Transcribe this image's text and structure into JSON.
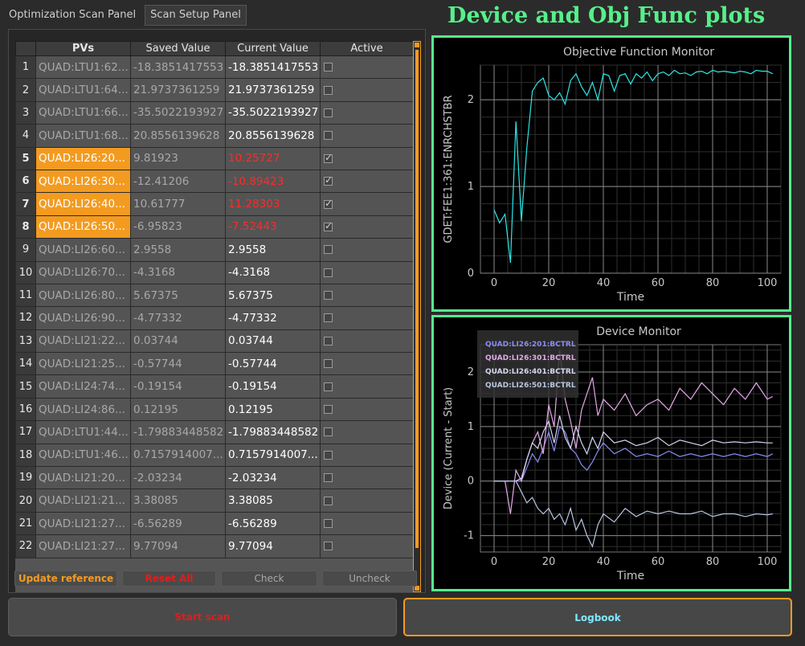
{
  "tabs": [
    {
      "label": "Optimization Scan Panel",
      "active": true
    },
    {
      "label": "Scan Setup Panel",
      "active": false
    }
  ],
  "table": {
    "headers": [
      "PVs",
      "Saved Value",
      "Current Value",
      "Active"
    ],
    "rows": [
      {
        "n": "1",
        "pv": "QUAD:LTU1:62...",
        "saved": "-18.3851417553",
        "current": "-18.3851417553",
        "active": false
      },
      {
        "n": "2",
        "pv": "QUAD:LTU1:64...",
        "saved": "21.9737361259",
        "current": "21.9737361259",
        "active": false
      },
      {
        "n": "3",
        "pv": "QUAD:LTU1:66...",
        "saved": "-35.5022193927",
        "current": "-35.5022193927",
        "active": false
      },
      {
        "n": "4",
        "pv": "QUAD:LTU1:68...",
        "saved": "20.8556139628",
        "current": "20.8556139628",
        "active": false
      },
      {
        "n": "5",
        "pv": "QUAD:LI26:20...",
        "saved": "9.81923",
        "current": "10.25727",
        "active": true
      },
      {
        "n": "6",
        "pv": "QUAD:LI26:30...",
        "saved": "-12.41206",
        "current": "-10.89423",
        "active": true
      },
      {
        "n": "7",
        "pv": "QUAD:LI26:40...",
        "saved": "10.61777",
        "current": "11.28303",
        "active": true
      },
      {
        "n": "8",
        "pv": "QUAD:LI26:50...",
        "saved": "-6.95823",
        "current": "-7.52443",
        "active": true
      },
      {
        "n": "9",
        "pv": "QUAD:LI26:60...",
        "saved": "2.9558",
        "current": "2.9558",
        "active": false
      },
      {
        "n": "10",
        "pv": "QUAD:LI26:70...",
        "saved": "-4.3168",
        "current": "-4.3168",
        "active": false
      },
      {
        "n": "11",
        "pv": "QUAD:LI26:80...",
        "saved": "5.67375",
        "current": "5.67375",
        "active": false
      },
      {
        "n": "12",
        "pv": "QUAD:LI26:90...",
        "saved": "-4.77332",
        "current": "-4.77332",
        "active": false
      },
      {
        "n": "13",
        "pv": "QUAD:LI21:22...",
        "saved": "0.03744",
        "current": "0.03744",
        "active": false
      },
      {
        "n": "14",
        "pv": "QUAD:LI21:25...",
        "saved": "-0.57744",
        "current": "-0.57744",
        "active": false
      },
      {
        "n": "15",
        "pv": "QUAD:LI24:74...",
        "saved": "-0.19154",
        "current": "-0.19154",
        "active": false
      },
      {
        "n": "16",
        "pv": "QUAD:LI24:86...",
        "saved": "0.12195",
        "current": "0.12195",
        "active": false
      },
      {
        "n": "17",
        "pv": "QUAD:LTU1:44...",
        "saved": "-1.79883448582",
        "current": "-1.79883448582",
        "active": false
      },
      {
        "n": "18",
        "pv": "QUAD:LTU1:46...",
        "saved": "0.7157914007...",
        "current": "0.7157914007...",
        "active": false
      },
      {
        "n": "19",
        "pv": "QUAD:LI21:20...",
        "saved": "-2.03234",
        "current": "-2.03234",
        "active": false
      },
      {
        "n": "20",
        "pv": "QUAD:LI21:21...",
        "saved": "3.38085",
        "current": "3.38085",
        "active": false
      },
      {
        "n": "21",
        "pv": "QUAD:LI21:27...",
        "saved": "-6.56289",
        "current": "-6.56289",
        "active": false
      },
      {
        "n": "22",
        "pv": "QUAD:LI21:27...",
        "saved": "9.77094",
        "current": "9.77094",
        "active": false
      }
    ]
  },
  "buttons": {
    "update_reference": "Update reference",
    "reset_all": "Reset All",
    "check": "Check",
    "uncheck": "Uncheck",
    "start_scan": "Start scan",
    "logbook": "Logbook"
  },
  "header_title": "Device and Obj Func plots",
  "colors": {
    "accent_orange": "#f39b21",
    "panel_green": "#55f08a",
    "changed_red": "#ff2a2a",
    "obj_line": "#2ee6e6"
  },
  "chart_data": [
    {
      "type": "line",
      "title": "Objective Function Monitor",
      "xlabel": "Time",
      "ylabel": "GDET:FEE1:361:ENRCHSTBR",
      "xlim": [
        -5,
        105
      ],
      "ylim": [
        0,
        2.4
      ],
      "xticks": [
        0,
        20,
        40,
        60,
        80,
        100
      ],
      "yticks": [
        0,
        1,
        2
      ],
      "grid": true,
      "series": [
        {
          "color": "#2ee6e6",
          "x": [
            0,
            2,
            4,
            6,
            8,
            10,
            12,
            14,
            16,
            18,
            20,
            22,
            24,
            26,
            28,
            30,
            32,
            34,
            36,
            38,
            40,
            42,
            44,
            46,
            48,
            50,
            52,
            54,
            56,
            58,
            60,
            62,
            64,
            66,
            68,
            70,
            72,
            74,
            76,
            78,
            80,
            82,
            84,
            86,
            88,
            90,
            92,
            94,
            96,
            98,
            100,
            102
          ],
          "y": [
            0.73,
            0.58,
            0.68,
            0.12,
            1.75,
            0.6,
            1.45,
            2.1,
            2.2,
            2.25,
            2.05,
            2.0,
            2.08,
            1.95,
            2.22,
            2.3,
            2.15,
            2.05,
            2.2,
            2.0,
            2.3,
            2.28,
            2.1,
            2.28,
            2.3,
            2.18,
            2.3,
            2.25,
            2.32,
            2.22,
            2.3,
            2.32,
            2.28,
            2.34,
            2.3,
            2.31,
            2.28,
            2.32,
            2.33,
            2.3,
            2.34,
            2.32,
            2.33,
            2.32,
            2.31,
            2.33,
            2.32,
            2.3,
            2.34,
            2.33,
            2.33,
            2.3
          ]
        }
      ]
    },
    {
      "type": "line",
      "title": "Device Monitor",
      "xlabel": "Time",
      "ylabel": "Device (Current - Start)",
      "xlim": [
        -5,
        105
      ],
      "ylim": [
        -1.3,
        2.5
      ],
      "xticks": [
        0,
        20,
        40,
        60,
        80,
        100
      ],
      "yticks": [
        -1,
        0,
        1,
        2
      ],
      "grid": true,
      "legend_position": "top-left",
      "series": [
        {
          "name": "QUAD:LI26:201:BCTRL",
          "color": "#8a8cf2",
          "x": [
            0,
            4,
            8,
            10,
            12,
            14,
            16,
            18,
            20,
            22,
            24,
            26,
            28,
            30,
            32,
            34,
            36,
            38,
            40,
            44,
            48,
            52,
            56,
            60,
            64,
            68,
            72,
            76,
            80,
            84,
            88,
            92,
            96,
            100,
            102
          ],
          "y": [
            0,
            0,
            0,
            0,
            0.25,
            0.5,
            0.35,
            0.6,
            0.9,
            0.55,
            1.0,
            0.9,
            0.6,
            0.5,
            0.3,
            0.2,
            0.35,
            0.55,
            0.7,
            0.5,
            0.6,
            0.45,
            0.5,
            0.45,
            0.55,
            0.45,
            0.5,
            0.45,
            0.5,
            0.45,
            0.5,
            0.45,
            0.5,
            0.45,
            0.5
          ]
        },
        {
          "name": "QUAD:LI26:301:BCTRL",
          "color": "#e4a8e8",
          "x": [
            0,
            4,
            6,
            8,
            10,
            12,
            14,
            16,
            18,
            20,
            22,
            24,
            26,
            28,
            30,
            32,
            34,
            36,
            38,
            40,
            44,
            48,
            52,
            56,
            60,
            64,
            68,
            72,
            76,
            80,
            84,
            88,
            92,
            96,
            100,
            102
          ],
          "y": [
            0,
            0,
            -0.6,
            0.2,
            0,
            0.4,
            0.7,
            0.9,
            0.5,
            1.4,
            1.0,
            2.4,
            1.5,
            1.1,
            0.6,
            1.3,
            1.6,
            1.9,
            1.2,
            1.5,
            1.3,
            1.6,
            1.2,
            1.4,
            1.5,
            1.3,
            1.7,
            1.5,
            1.8,
            1.6,
            1.4,
            1.7,
            1.5,
            1.8,
            1.5,
            1.55
          ]
        },
        {
          "name": "QUAD:LI26:401:BCTRL",
          "color": "#d6d6f0",
          "x": [
            0,
            4,
            8,
            10,
            12,
            14,
            16,
            18,
            20,
            22,
            24,
            26,
            28,
            30,
            32,
            34,
            36,
            38,
            40,
            44,
            48,
            52,
            56,
            60,
            64,
            68,
            72,
            76,
            80,
            84,
            88,
            92,
            96,
            100,
            102
          ],
          "y": [
            0,
            0,
            0,
            0.05,
            0.4,
            0.7,
            0.6,
            0.9,
            1.1,
            0.7,
            1.2,
            0.8,
            0.6,
            1.0,
            0.7,
            0.5,
            0.8,
            0.6,
            0.9,
            0.7,
            0.75,
            0.65,
            0.7,
            0.8,
            0.65,
            0.75,
            0.7,
            0.65,
            0.75,
            0.7,
            0.72,
            0.7,
            0.72,
            0.7,
            0.7
          ]
        },
        {
          "name": "QUAD:LI26:501:BCTRL",
          "color": "#b8c6e0",
          "x": [
            0,
            4,
            8,
            10,
            12,
            14,
            16,
            18,
            20,
            22,
            24,
            26,
            28,
            30,
            32,
            34,
            36,
            38,
            40,
            44,
            48,
            52,
            56,
            60,
            64,
            68,
            72,
            76,
            80,
            84,
            88,
            92,
            96,
            100,
            102
          ],
          "y": [
            0,
            0,
            0,
            -0.2,
            -0.4,
            -0.3,
            -0.5,
            -0.6,
            -0.5,
            -0.7,
            -0.6,
            -0.8,
            -0.5,
            -0.9,
            -0.7,
            -1.0,
            -1.2,
            -0.8,
            -0.6,
            -0.75,
            -0.5,
            -0.65,
            -0.55,
            -0.6,
            -0.55,
            -0.6,
            -0.6,
            -0.55,
            -0.65,
            -0.6,
            -0.6,
            -0.65,
            -0.6,
            -0.62,
            -0.6
          ]
        }
      ]
    }
  ]
}
